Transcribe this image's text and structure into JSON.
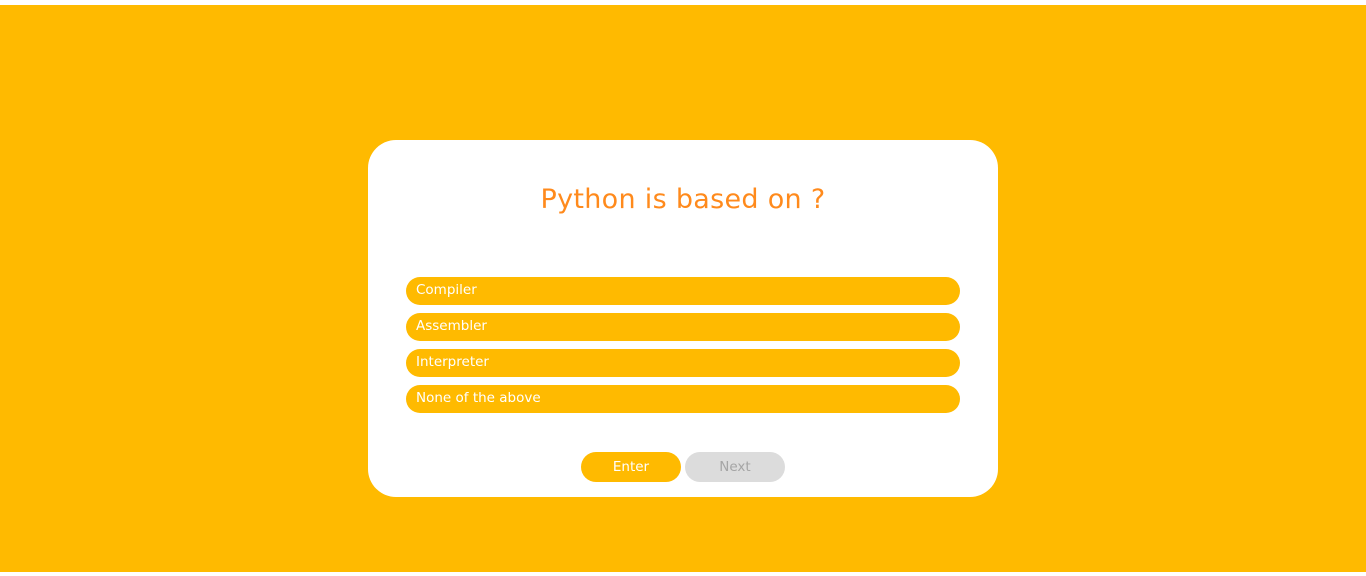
{
  "quiz": {
    "question": "Python is based on ?",
    "options": [
      {
        "label": "Compiler"
      },
      {
        "label": "Assembler"
      },
      {
        "label": "Interpreter"
      },
      {
        "label": "None of the above"
      }
    ],
    "enter_label": "Enter",
    "next_label": "Next"
  },
  "colors": {
    "background": "#ffba00",
    "card": "#ffffff",
    "question_text": "#ff8a1c",
    "option_bg": "#ffba00",
    "option_text": "#ffffff",
    "next_disabled_bg": "#dcdcdc",
    "next_disabled_text": "#a5a5a5"
  }
}
